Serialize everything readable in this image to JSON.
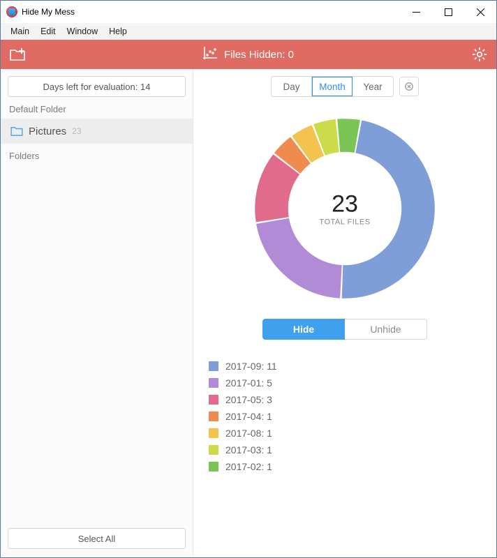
{
  "window": {
    "title": "Hide My Mess"
  },
  "menubar": {
    "items": [
      "Main",
      "Edit",
      "Window",
      "Help"
    ]
  },
  "toolbar": {
    "status_label": "Files Hidden: 0"
  },
  "sidebar": {
    "eval_text": "Days left for evaluation: 14",
    "section_default": "Default Folder",
    "default_folder": {
      "name": "Pictures",
      "count": "23"
    },
    "section_folders": "Folders",
    "select_all": "Select All"
  },
  "time_tabs": {
    "day": "Day",
    "month": "Month",
    "year": "Year",
    "active": "month"
  },
  "actions": {
    "hide": "Hide",
    "unhide": "Unhide",
    "active": "hide"
  },
  "chart_center": {
    "number": "23",
    "label": "TOTAL FILES"
  },
  "chart_data": {
    "type": "pie",
    "title": "",
    "series": [
      {
        "name": "2017-09",
        "value": 11,
        "color": "#7f9dd6"
      },
      {
        "name": "2017-01",
        "value": 5,
        "color": "#b18bd6"
      },
      {
        "name": "2017-05",
        "value": 3,
        "color": "#e16b8c"
      },
      {
        "name": "2017-04",
        "value": 1,
        "color": "#f08b4f"
      },
      {
        "name": "2017-08",
        "value": 1,
        "color": "#f4c24f"
      },
      {
        "name": "2017-03",
        "value": 1,
        "color": "#cbdb4a"
      },
      {
        "name": "2017-02",
        "value": 1,
        "color": "#7ac554"
      }
    ]
  }
}
